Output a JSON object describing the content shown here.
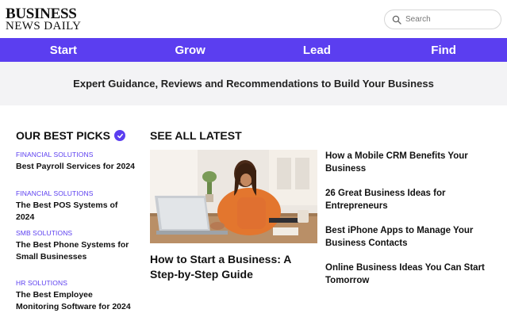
{
  "header": {
    "logo_line1": "BUSINESS",
    "logo_line2": "NEWS DAILY",
    "search_placeholder": "Search"
  },
  "nav": {
    "items": [
      {
        "label": "Start"
      },
      {
        "label": "Grow"
      },
      {
        "label": "Lead"
      },
      {
        "label": "Find"
      }
    ]
  },
  "banner": {
    "text": "Expert Guidance, Reviews and Recommendations to Build Your Business"
  },
  "best_picks": {
    "heading": "OUR BEST PICKS",
    "items": [
      {
        "category": "FINANCIAL SOLUTIONS",
        "title": "Best Payroll Services for 2024"
      },
      {
        "category": "FINANCIAL SOLUTIONS",
        "title": "The Best POS Systems of 2024"
      },
      {
        "category": "SMB SOLUTIONS",
        "title": "The Best Phone Systems for Small Businesses"
      },
      {
        "category": "HR SOLUTIONS",
        "title": "The Best Employee Monitoring Software for 2024"
      }
    ]
  },
  "latest": {
    "heading": "SEE ALL LATEST",
    "feature_title": "How to Start a Business: A Step-by-Step Guide",
    "items": [
      {
        "title": "How a Mobile CRM Benefits Your Business"
      },
      {
        "title": "26 Great Business Ideas for Entrepreneurs"
      },
      {
        "title": "Best iPhone Apps to Manage Your Business Contacts"
      },
      {
        "title": "Online Business Ideas You Can Start Tomorrow"
      }
    ]
  },
  "colors": {
    "accent": "#5b3ef0",
    "banner_bg": "#f3f3f5"
  }
}
